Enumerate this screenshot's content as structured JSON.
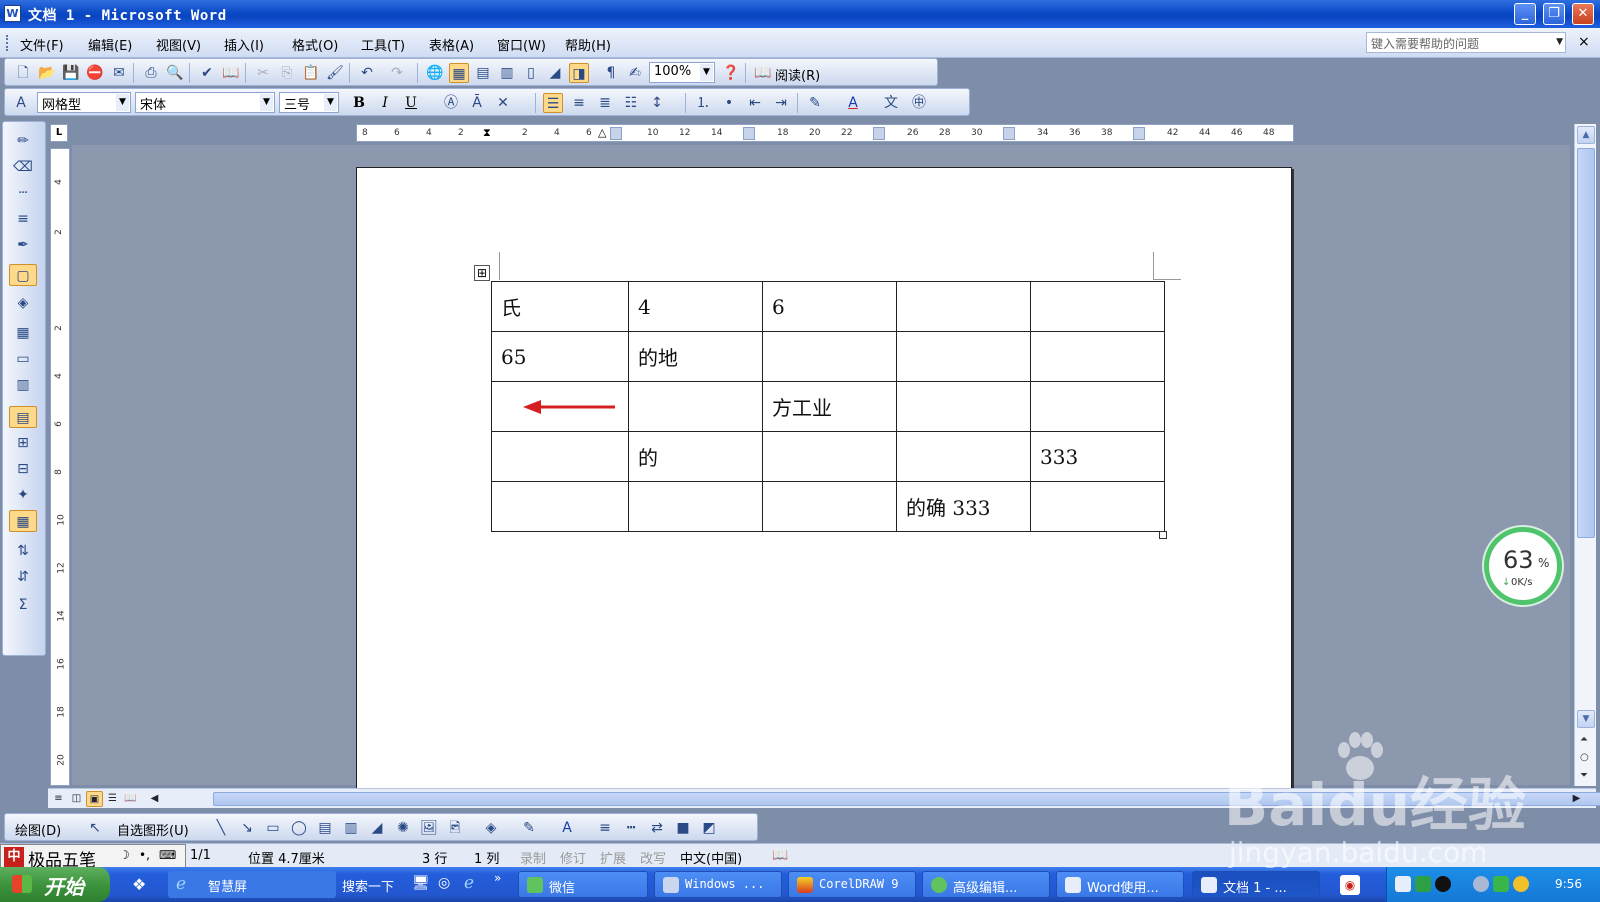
{
  "window": {
    "title": "文档 1 - Microsoft Word",
    "app_icon": "W",
    "minimize": "_",
    "restore": "❐",
    "close": "✕"
  },
  "menu": {
    "items": [
      "文件(F)",
      "编辑(E)",
      "视图(V)",
      "插入(I)",
      "格式(O)",
      "工具(T)",
      "表格(A)",
      "窗口(W)",
      "帮助(H)"
    ],
    "help_placeholder": "键入需要帮助的问题",
    "close_glyph": "×"
  },
  "toolbar_standard": {
    "zoom": "100%",
    "read_label": "阅读(R)"
  },
  "toolbar_format": {
    "style": "网格型",
    "font": "宋体",
    "size": "三号",
    "bold": "B",
    "italic": "I",
    "underline": "U"
  },
  "ruler": {
    "corner": "L",
    "h_numbers": [
      "8",
      "6",
      "4",
      "2",
      "2",
      "4",
      "6",
      "10",
      "12",
      "14",
      "18",
      "20",
      "22",
      "26",
      "28",
      "30",
      "34",
      "36",
      "38",
      "42",
      "44",
      "46",
      "48"
    ],
    "v_numbers": [
      "4",
      "2",
      "2",
      "4",
      "6",
      "8",
      "10",
      "12",
      "14",
      "16",
      "18",
      "20"
    ]
  },
  "document": {
    "table": [
      [
        "氏",
        "4",
        "6",
        "",
        ""
      ],
      [
        "65",
        "的地",
        "",
        "",
        ""
      ],
      [
        "",
        "",
        "方工业",
        "",
        ""
      ],
      [
        "",
        "的",
        "",
        "",
        "333"
      ],
      [
        "",
        "",
        "",
        "的确 333",
        ""
      ]
    ],
    "annotation_color": "#d42020"
  },
  "drawing_toolbar": {
    "draw": "绘图(D)",
    "autoshape": "自选图形(U)"
  },
  "status": {
    "ime_name": "极品五笔",
    "page": "1/1",
    "position": "位置 4.7厘米",
    "line": "3 行",
    "column": "1 列",
    "rec": "录制",
    "trk": "修订",
    "ext": "扩展",
    "ovr": "改写",
    "language": "中文(中国)"
  },
  "taskbar": {
    "start": "开始",
    "ql_label": "智慧屏",
    "search": "搜索一下",
    "items": [
      "微信",
      "Windows ...",
      "CorelDRAW 9",
      "高级编辑...",
      "Word使用...",
      "文档 1 - ..."
    ],
    "clock": "9:56"
  },
  "speed_widget": {
    "percent": "63",
    "percent_symbol": "%",
    "rate": "0K/s"
  },
  "watermark": {
    "brand": "Baidu经验",
    "url": "jingyan.baidu.com"
  }
}
